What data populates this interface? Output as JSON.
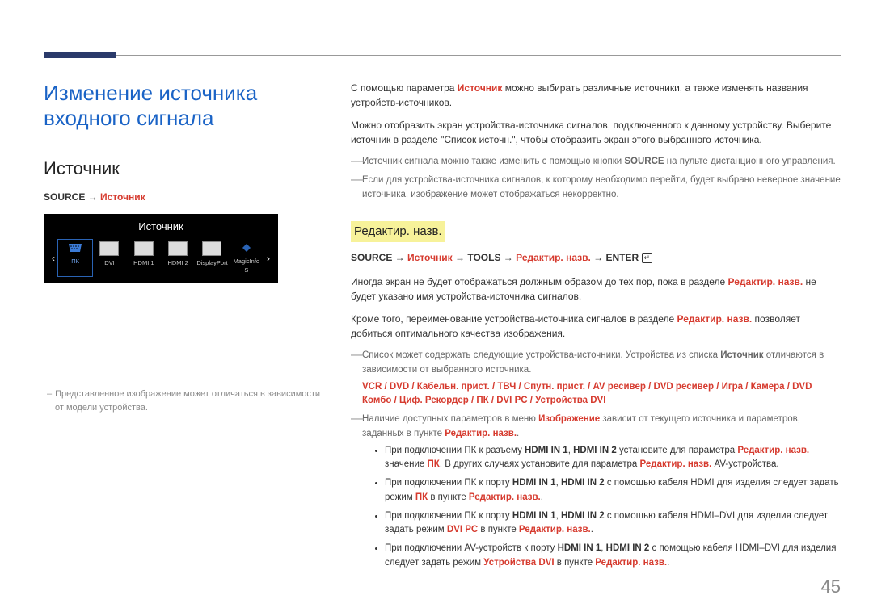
{
  "page_number": "45",
  "left": {
    "title": "Изменение источника входного сигнала",
    "section": "Источник",
    "path_prefix": "SOURCE →",
    "path_red": "Источник",
    "ui": {
      "title": "Источник",
      "nav_left": "‹",
      "nav_right": "›",
      "items": [
        {
          "label": "ПК",
          "type": "vga",
          "selected": true
        },
        {
          "label": "DVI",
          "type": "port",
          "selected": false
        },
        {
          "label": "HDMI 1",
          "type": "port",
          "selected": false
        },
        {
          "label": "HDMI 2",
          "type": "port",
          "selected": false
        },
        {
          "label": "DisplayPort",
          "type": "port",
          "selected": false
        },
        {
          "label": "MagicInfo S",
          "type": "mi",
          "selected": false
        }
      ]
    },
    "disclaimer": "Представленное изображение может отличаться в зависимости от модели устройства."
  },
  "right": {
    "p1_a": "С помощью параметра ",
    "p1_red": "Источник",
    "p1_b": " можно выбирать различные источники, а также изменять названия устройств-источников.",
    "p2": "Можно отобразить экран устройства-источника сигналов, подключенного к данному устройству. Выберите источник в разделе \"Список источн.\", чтобы отобразить экран этого выбранного источника.",
    "d1_a": "Источник сигнала можно также изменить с помощью кнопки ",
    "d1_b": "SOURCE",
    "d1_c": " на пульте дистанционного управления.",
    "d2": "Если для устройства-источника сигналов, к которому необходимо перейти, будет выбрано неверное значение источника, изображение может отображаться некорректно.",
    "hl": "Редактир. назв.",
    "path2_a": "SOURCE",
    "path2_b": "Источник",
    "path2_c": "TOOLS",
    "path2_d": "Редактир. назв.",
    "path2_e": "ENTER",
    "enter_glyph": "↵",
    "p3_a": "Иногда экран не будет отображаться должным образом до тех пор, пока в разделе ",
    "p3_red": "Редактир. назв.",
    "p3_b": " не будет указано имя устройства-источника сигналов.",
    "p4_a": "Кроме того, переименование устройства-источника сигналов в разделе ",
    "p4_red": "Редактир. назв.",
    "p4_b": " позволяет добиться оптимального качества изображения.",
    "d3_a": "Список может содержать следующие устройства-источники. Устройства из списка ",
    "d3_b": "Источник",
    "d3_c": " отличаются в зависимости от выбранного источника.",
    "d3_list": "VCR / DVD / Кабельн. прист. / ТВЧ / Спутн. прист. / AV ресивер / DVD ресивер / Игра / Камера / DVD Комбо / Циф. Рекордер / ПК / DVI PC / Устройства DVI",
    "d4_a": "Наличие доступных параметров в меню ",
    "d4_red": "Изображение",
    "d4_b": " зависит от текущего источника и параметров, заданных в пункте ",
    "d4_red2": "Редактир. назв.",
    "d4_c": ".",
    "b1_a": "При подключении ПК к разъему ",
    "b1_h1": "HDMI IN 1",
    "b1_sep": ", ",
    "b1_h2": "HDMI IN 2",
    "b1_b": " установите для параметра ",
    "b1_red": "Редактир. назв.",
    "b1_c": " значение ",
    "b1_red2": "ПК",
    "b1_d": ". В других случаях установите для параметра ",
    "b1_red3": "Редактир. назв.",
    "b1_e": " AV-устройства.",
    "b2_a": "При подключении ПК к порту ",
    "b2_h1": "HDMI IN 1",
    "b2_sep": ", ",
    "b2_h2": "HDMI IN 2",
    "b2_b": " с помощью кабеля HDMI для изделия следует задать режим ",
    "b2_red": "ПК",
    "b2_c": " в пункте ",
    "b2_red2": "Редактир. назв.",
    "b2_d": ".",
    "b3_a": "При подключении ПК к порту ",
    "b3_h1": "HDMI IN 1",
    "b3_sep": ", ",
    "b3_h2": "HDMI IN 2",
    "b3_b": " с помощью кабеля HDMI–DVI для изделия следует задать режим ",
    "b3_red": "DVI PC",
    "b3_c": " в пункте ",
    "b3_red2": "Редактир. назв.",
    "b3_d": ".",
    "b4_a": "При подключении AV-устройств к порту ",
    "b4_h1": "HDMI IN 1",
    "b4_sep": ", ",
    "b4_h2": "HDMI IN 2",
    "b4_b": " с помощью кабеля HDMI–DVI для изделия следует задать режим ",
    "b4_red": "Устройства DVI",
    "b4_c": " в пункте ",
    "b4_red2": "Редактир. назв.",
    "b4_d": "."
  }
}
